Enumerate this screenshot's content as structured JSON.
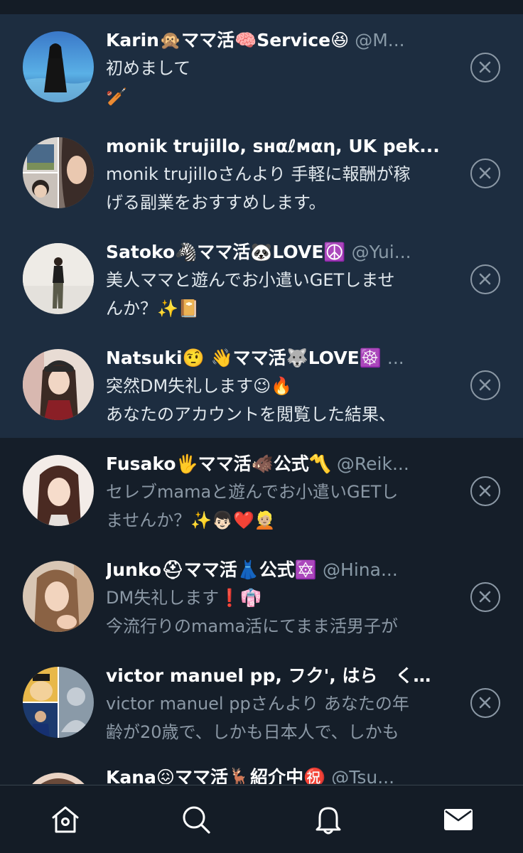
{
  "theme": {
    "background": "#151e29",
    "unread_row": "#1d2d40",
    "name_color": "#ffffff",
    "handle_color": "#8899a6",
    "read_text": "#8b98a5",
    "icon_color": "#ffffff"
  },
  "conversations": [
    {
      "name": "Karin🙊ママ活🧠Service😆",
      "handle": "@M...",
      "message_lines": [
        "初めまして",
        "🏏"
      ],
      "unread": true
    },
    {
      "name": "monik trujillo, sнαℓмαη, UK pek...",
      "handle": "",
      "message_lines": [
        "monik trujilloさんより 手軽に報酬が稼",
        "げる副業をおすすめします。"
      ],
      "unread": true
    },
    {
      "name": "Satoko🦓ママ活🐼LOVE☮️",
      "handle": "@Yui...",
      "message_lines": [
        "美人ママと遊んでお小遣いGETしませ",
        "んか？✨📔"
      ],
      "unread": true
    },
    {
      "name": "Natsuki🤨 👋ママ活🐺LOVE☸️",
      "handle": "...",
      "message_lines": [
        "突然DM失礼します😉🔥",
        "あなたのアカウントを閲覧した結果、"
      ],
      "unread": true
    },
    {
      "name": "Fusako🖐ママ活🐗公式〽️",
      "handle": "@Reik...",
      "message_lines": [
        "セレブmamaと遊んでお小遣いGETし",
        "ませんか？✨👦🏻❤️👱🏼"
      ],
      "unread": false
    },
    {
      "name": "Junko⛑ママ活👗公式🔯",
      "handle": "@Hina...",
      "message_lines": [
        "DM失礼します❗️👘",
        "今流行りのmama活にてまま活男子が"
      ],
      "unread": false
    },
    {
      "name": "victor manuel pp, フク', はら　く…",
      "handle": "",
      "message_lines": [
        "victor manuel ppさんより あなたの年",
        "齢が20歳で、しかも日本人で、しかも"
      ],
      "unread": false
    },
    {
      "name": "Kana😖ママ活🦌紹介中㊗️",
      "handle": "@Tsu...",
      "message_lines": [],
      "unread": false
    }
  ],
  "tabbar": {
    "tabs": [
      {
        "id": "home",
        "icon": "home-icon",
        "active": false
      },
      {
        "id": "search",
        "icon": "search-icon",
        "active": false
      },
      {
        "id": "notifications",
        "icon": "bell-icon",
        "active": false
      },
      {
        "id": "messages",
        "icon": "envelope-icon",
        "active": true
      }
    ]
  }
}
